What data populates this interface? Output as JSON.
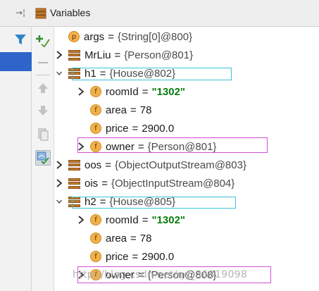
{
  "panel": {
    "title": "Variables",
    "pin_glyph": "→¦"
  },
  "toolbar": {
    "items": [
      {
        "icon": "add-watch-icon"
      },
      {
        "icon": "remove-watch-icon"
      },
      {
        "icon": "move-up-icon"
      },
      {
        "icon": "move-down-icon"
      },
      {
        "icon": "copy-icon"
      },
      {
        "icon": "show-watches-icon"
      }
    ]
  },
  "variables": [
    {
      "badge": "p",
      "name": "args",
      "value": "{String[0]@800}"
    },
    {
      "badge": "stack",
      "name": "MrLiu",
      "value": "{Person@801}"
    },
    {
      "badge": "stack",
      "name": "h1",
      "value": "{House@802}"
    },
    {
      "badge": "f",
      "name": "roomId",
      "value": "\"1302\""
    },
    {
      "badge": "f",
      "name": "area",
      "value": "78"
    },
    {
      "badge": "f",
      "name": "price",
      "value": "2900.0"
    },
    {
      "badge": "f",
      "name": "owner",
      "value": "{Person@801}"
    },
    {
      "badge": "stack",
      "name": "oos",
      "value": "{ObjectOutputStream@803}"
    },
    {
      "badge": "stack",
      "name": "ois",
      "value": "{ObjectInputStream@804}"
    },
    {
      "badge": "stack",
      "name": "h2",
      "value": "{House@805}"
    },
    {
      "badge": "f",
      "name": "roomId",
      "value": "\"1302\""
    },
    {
      "badge": "f",
      "name": "area",
      "value": "78"
    },
    {
      "badge": "f",
      "name": "price",
      "value": "2900.0"
    },
    {
      "badge": "f",
      "name": "owner",
      "value": "{Person@808}"
    }
  ],
  "watermark": "http://blog.csdn.net/qq_36819098",
  "colors": {
    "string_value": "#087e0f",
    "highlight_cyan": "#37c6d8",
    "highlight_magenta": "#d24fd6",
    "selection": "#2f65ca"
  }
}
